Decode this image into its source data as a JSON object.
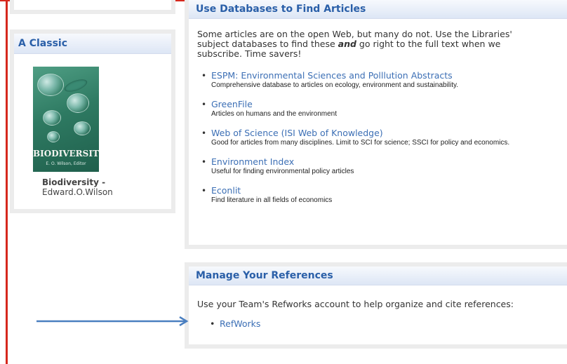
{
  "classic": {
    "header": "A Classic",
    "book_cover_title": "BIODIVERSITY",
    "book_cover_author": "E. O. Wilson, Editor",
    "caption_title": "Biodiversity",
    "caption_sep": " -",
    "caption_author": "Edward.O.Wilson"
  },
  "databases": {
    "header": "Use Databases to Find Articles",
    "intro_before": "Some articles are on the open Web, but many do not. Use the Libraries' subject databases to find these ",
    "intro_emph": "and",
    "intro_after": " go right to the full text when we subscribe. Time savers!",
    "items": [
      {
        "label": "ESPM: Environmental Sciences and Polllution Abstracts",
        "desc": "Comprehensive database to articles on ecology, environment and sustainability."
      },
      {
        "label": "GreenFile",
        "desc": "Articles on humans and the environment"
      },
      {
        "label": "Web of Science (ISI Web of Knowledge)",
        "desc": "Good for articles from many disciplines. Limit to SCI for science; SSCI for policy and economics."
      },
      {
        "label": "Environment Index",
        "desc": "Useful for finding environmental policy articles"
      },
      {
        "label": "Econlit",
        "desc": "Find literature in all fields of economics"
      }
    ]
  },
  "references": {
    "header": "Manage Your References",
    "intro": "Use your Team's Refworks account to help organize and cite references:",
    "link": "RefWorks"
  },
  "colors": {
    "frame": "#d6281d",
    "header_text": "#2a5fa8",
    "link": "#3c6fb5",
    "arrow": "#4a7fc0"
  },
  "icons": {
    "bullet": "bullet-icon",
    "arrow": "arrow-right-icon"
  }
}
